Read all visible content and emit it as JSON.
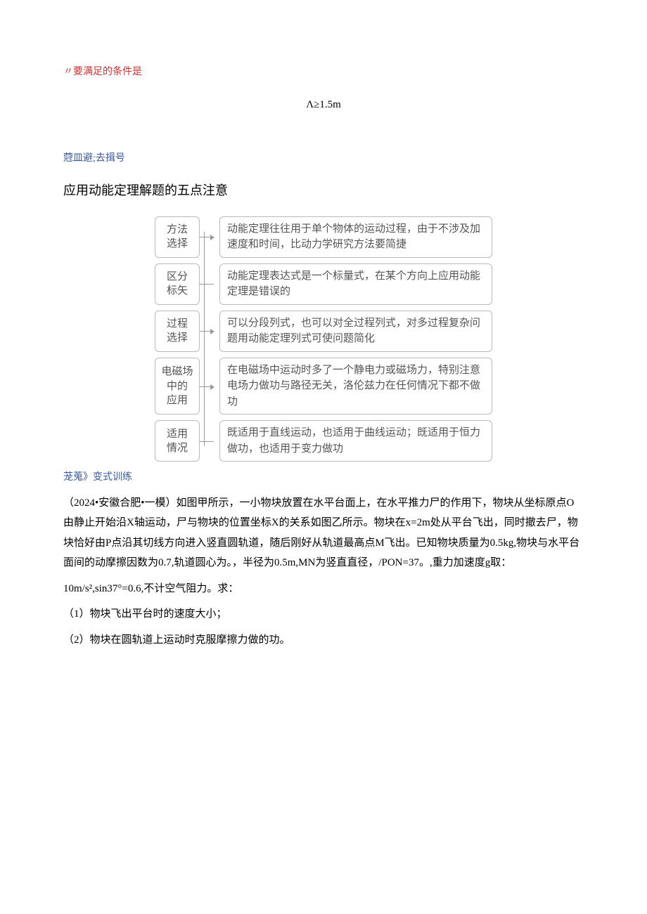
{
  "header": {
    "condition_note": "〃要满足的条件是",
    "inequality": "Λ≥1.5m"
  },
  "section1": {
    "tag": "蒄皿避;去揖号",
    "title": "应用动能定理解题的五点注意"
  },
  "diagram": {
    "rows": [
      {
        "left": "方法\n选择",
        "right": "动能定理往往用于单个物体的运动过程，由于不涉及加速度和时间，比动力学研究方法要简捷"
      },
      {
        "left": "区分\n标矢",
        "right": "动能定理表达式是一个标量式，在某个方向上应用动能定理是错误的"
      },
      {
        "left": "过程\n选择",
        "right": "可以分段列式，也可以对全过程列式，对多过程复杂问题用动能定理列式可使问题简化"
      },
      {
        "left": "电磁场\n中的\n应用",
        "right": "在电磁场中运动时多了一个静电力或磁场力，特别注意电场力做功与路径无关，洛伦兹力在任何情况下都不做功"
      },
      {
        "left": "适用\n情况",
        "right": "既适用于直线运动，也适用于曲线运动；既适用于恒力做功，也适用于变力做功"
      }
    ]
  },
  "section2": {
    "tag": "茏蒐》变式训练"
  },
  "problem": {
    "p1": "（2024•安徽合肥•一模）如图甲所示，一小物块放置在水平台面上，在水平推力尸的作用下，物块从坐标原点O由静止开始沿X轴运动，尸与物块的位置坐标X的关系如图乙所示。物块在x=2m处从平台飞出，同时撤去尸，物块恰好由P点沿其切线方向进入竖直圆轨道，随后刚好从轨道最高点M飞出。已知物块质量为0.5kg,物块与水平台面间的动摩擦因数为0.7,轨道圆心为。，半径为0.5m,MN为竖直直径，/PON=37。,重力加速度g取：",
    "p2": "10m/s²,sin37°=0.6,不计空气阻力。求：",
    "q1": "（1）物块飞出平台时的速度大小；",
    "q2": "（2）物块在圆轨道上运动时克服摩擦力做的功。"
  }
}
